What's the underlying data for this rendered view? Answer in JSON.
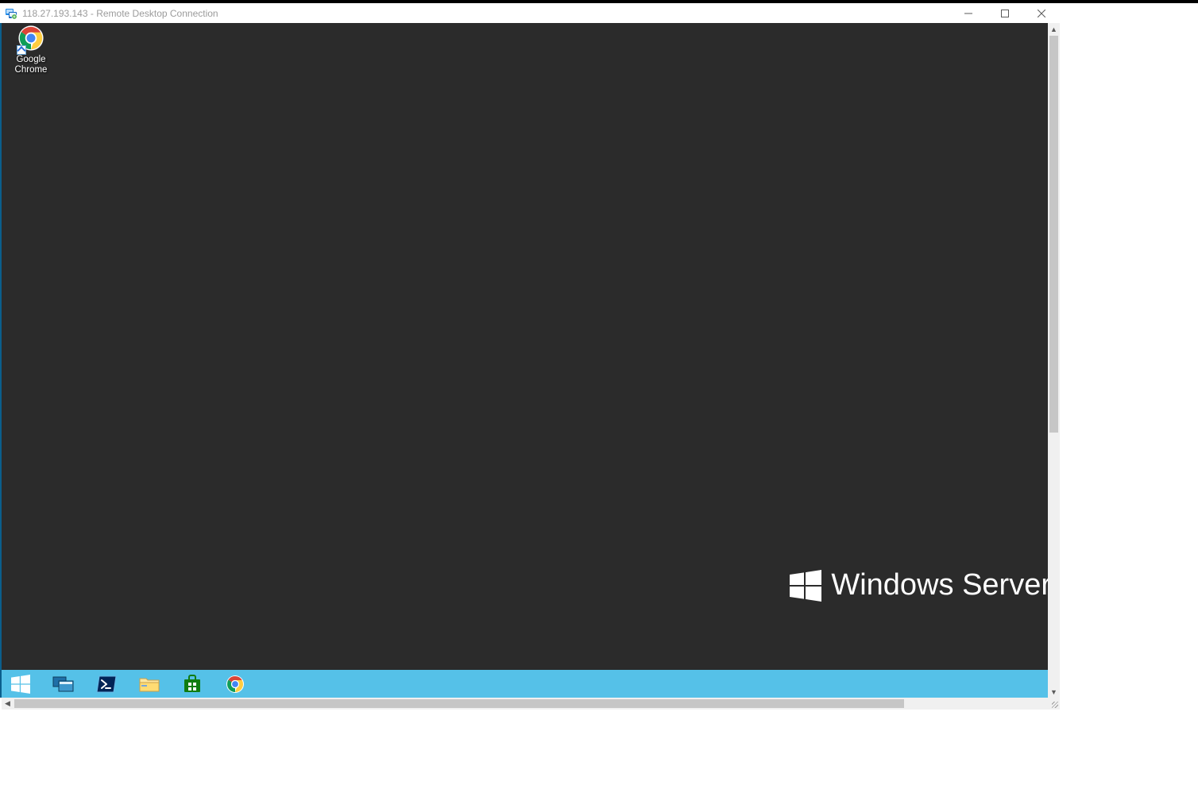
{
  "rdc": {
    "title": "118.27.193.143 - Remote Desktop Connection"
  },
  "desktop": {
    "icons": [
      {
        "label": "Google\nChrome"
      }
    ],
    "watermark": "Windows Server"
  },
  "taskbar": {
    "items": [
      {
        "name": "start"
      },
      {
        "name": "task-view"
      },
      {
        "name": "powershell"
      },
      {
        "name": "file-explorer"
      },
      {
        "name": "microsoft-store"
      },
      {
        "name": "google-chrome"
      }
    ]
  }
}
